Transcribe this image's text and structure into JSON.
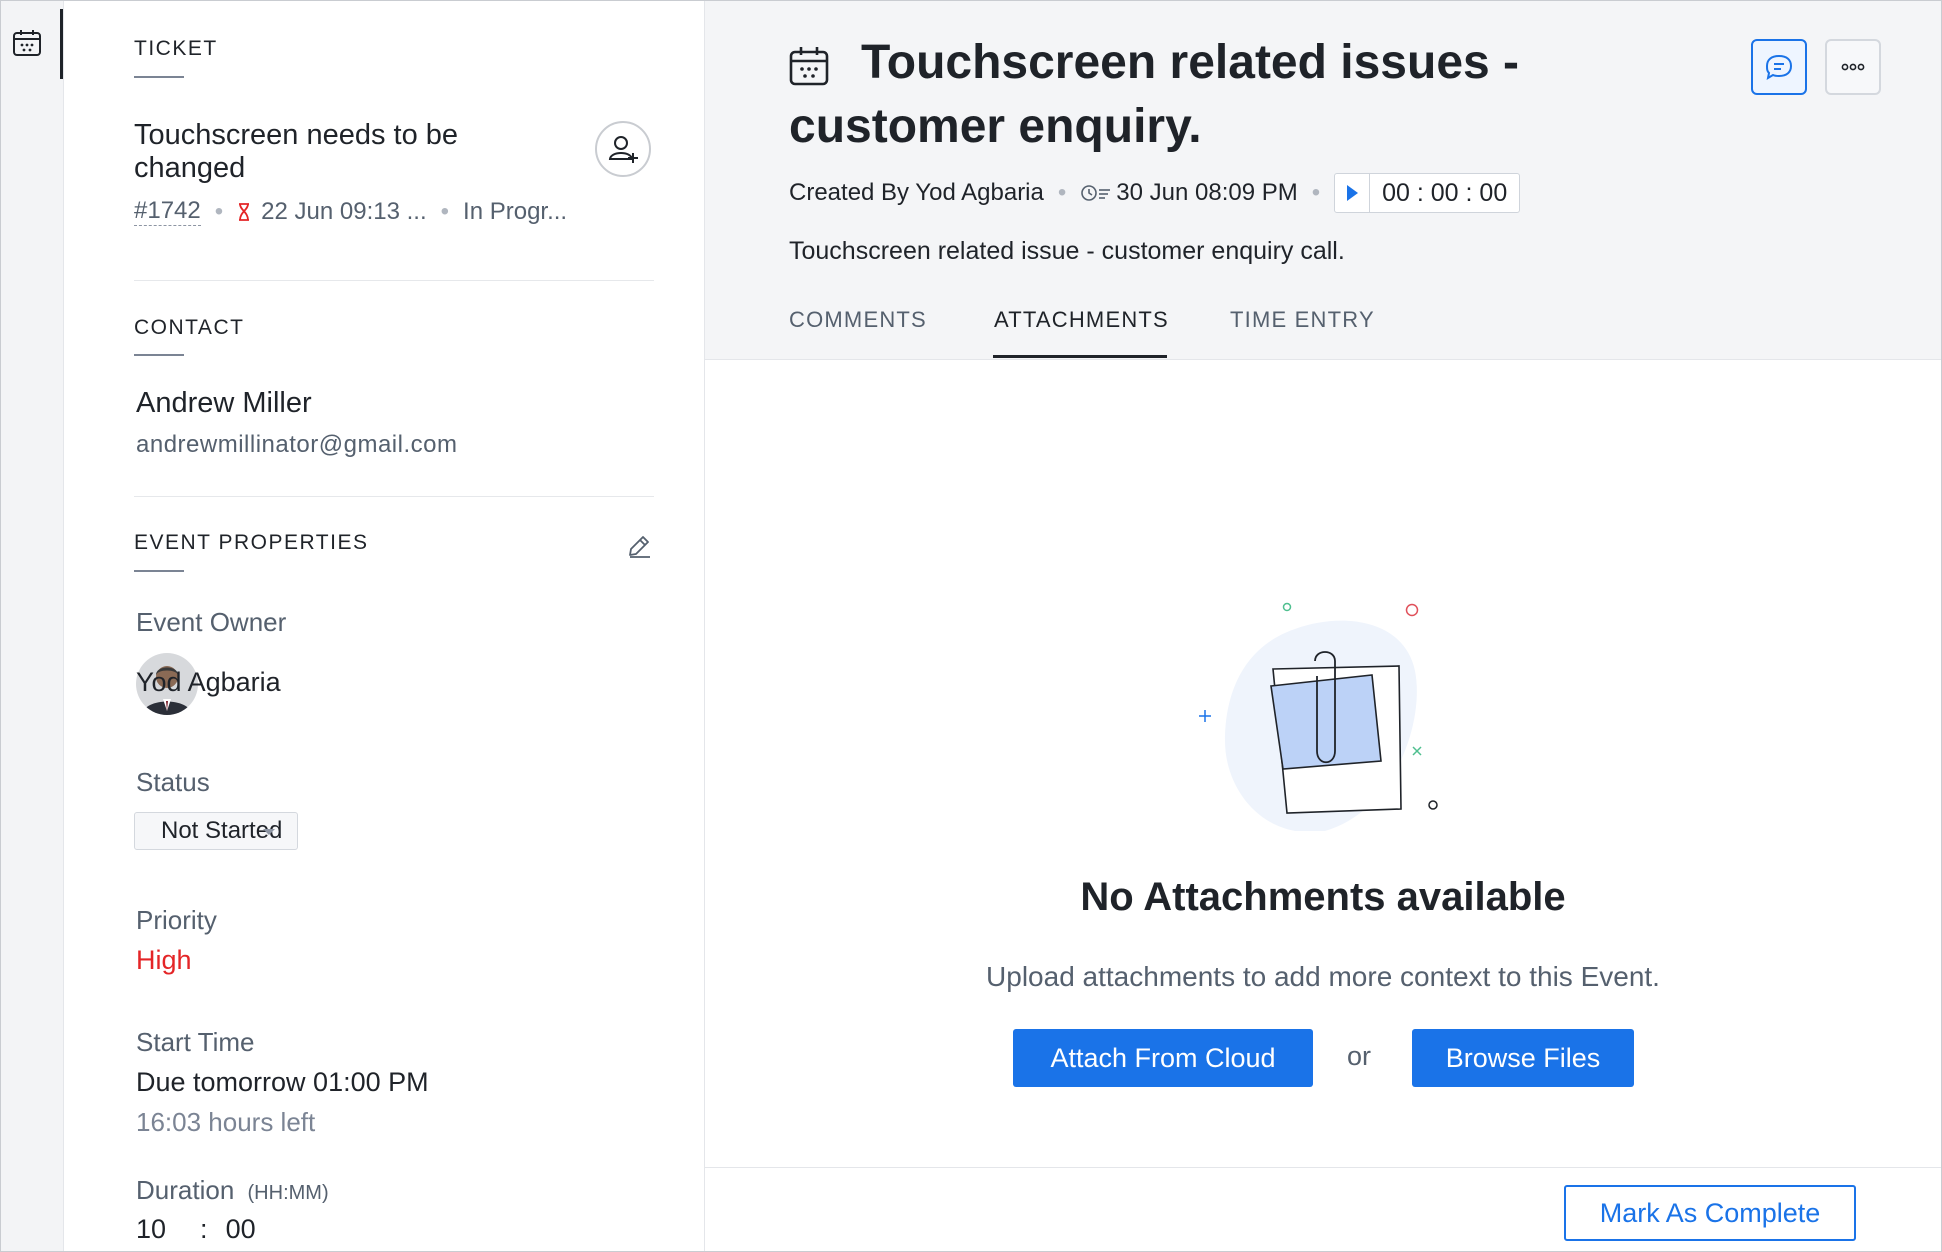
{
  "left": {
    "ticket": {
      "section": "TICKET",
      "title": "Touchscreen needs to be changed",
      "id": "#1742",
      "due": "22 Jun 09:13 ...",
      "status": "In Progr..."
    },
    "contact": {
      "section": "CONTACT",
      "name": "Andrew Miller",
      "email": "andrewmillinator@gmail.com"
    },
    "event": {
      "section": "EVENT PROPERTIES",
      "owner_label": "Event Owner",
      "owner_name": "Yod Agbaria",
      "status_label": "Status",
      "status_value": "Not Started",
      "priority_label": "Priority",
      "priority_value": "High",
      "priority_color": "#e42527",
      "start_label": "Start Time",
      "start_value": "Due tomorrow 01:00 PM",
      "start_left": "16:03 hours left",
      "duration_label": "Duration",
      "duration_unit": "(HH:MM)",
      "duration_hours": "10",
      "duration_sep": ":",
      "duration_minutes": "00"
    }
  },
  "right": {
    "title": "Touchscreen related issues - customer enquiry.",
    "created_by": "Created By Yod Agbaria",
    "created_at": "30 Jun 08:09 PM",
    "timer": "00 : 00 : 00",
    "description": "Touchscreen related issue - customer enquiry call.",
    "tabs": [
      {
        "label": "COMMENTS"
      },
      {
        "label": "ATTACHMENTS"
      },
      {
        "label": "TIME ENTRY"
      }
    ],
    "active_tab": "ATTACHMENTS",
    "empty": {
      "title": "No Attachments available",
      "subtitle": "Upload attachments to add more context to this Event.",
      "cloud_button": "Attach From Cloud",
      "or": "or",
      "browse_button": "Browse Files"
    },
    "complete_button": "Mark As Complete"
  },
  "colors": {
    "accent": "#1a73e8",
    "danger": "#e42527"
  },
  "icons": [
    "calendar-icon",
    "add-user-icon",
    "hourglass-icon",
    "edit-icon",
    "chat-icon",
    "more-icon",
    "clock-icon",
    "play-icon",
    "paperclip-icon"
  ]
}
